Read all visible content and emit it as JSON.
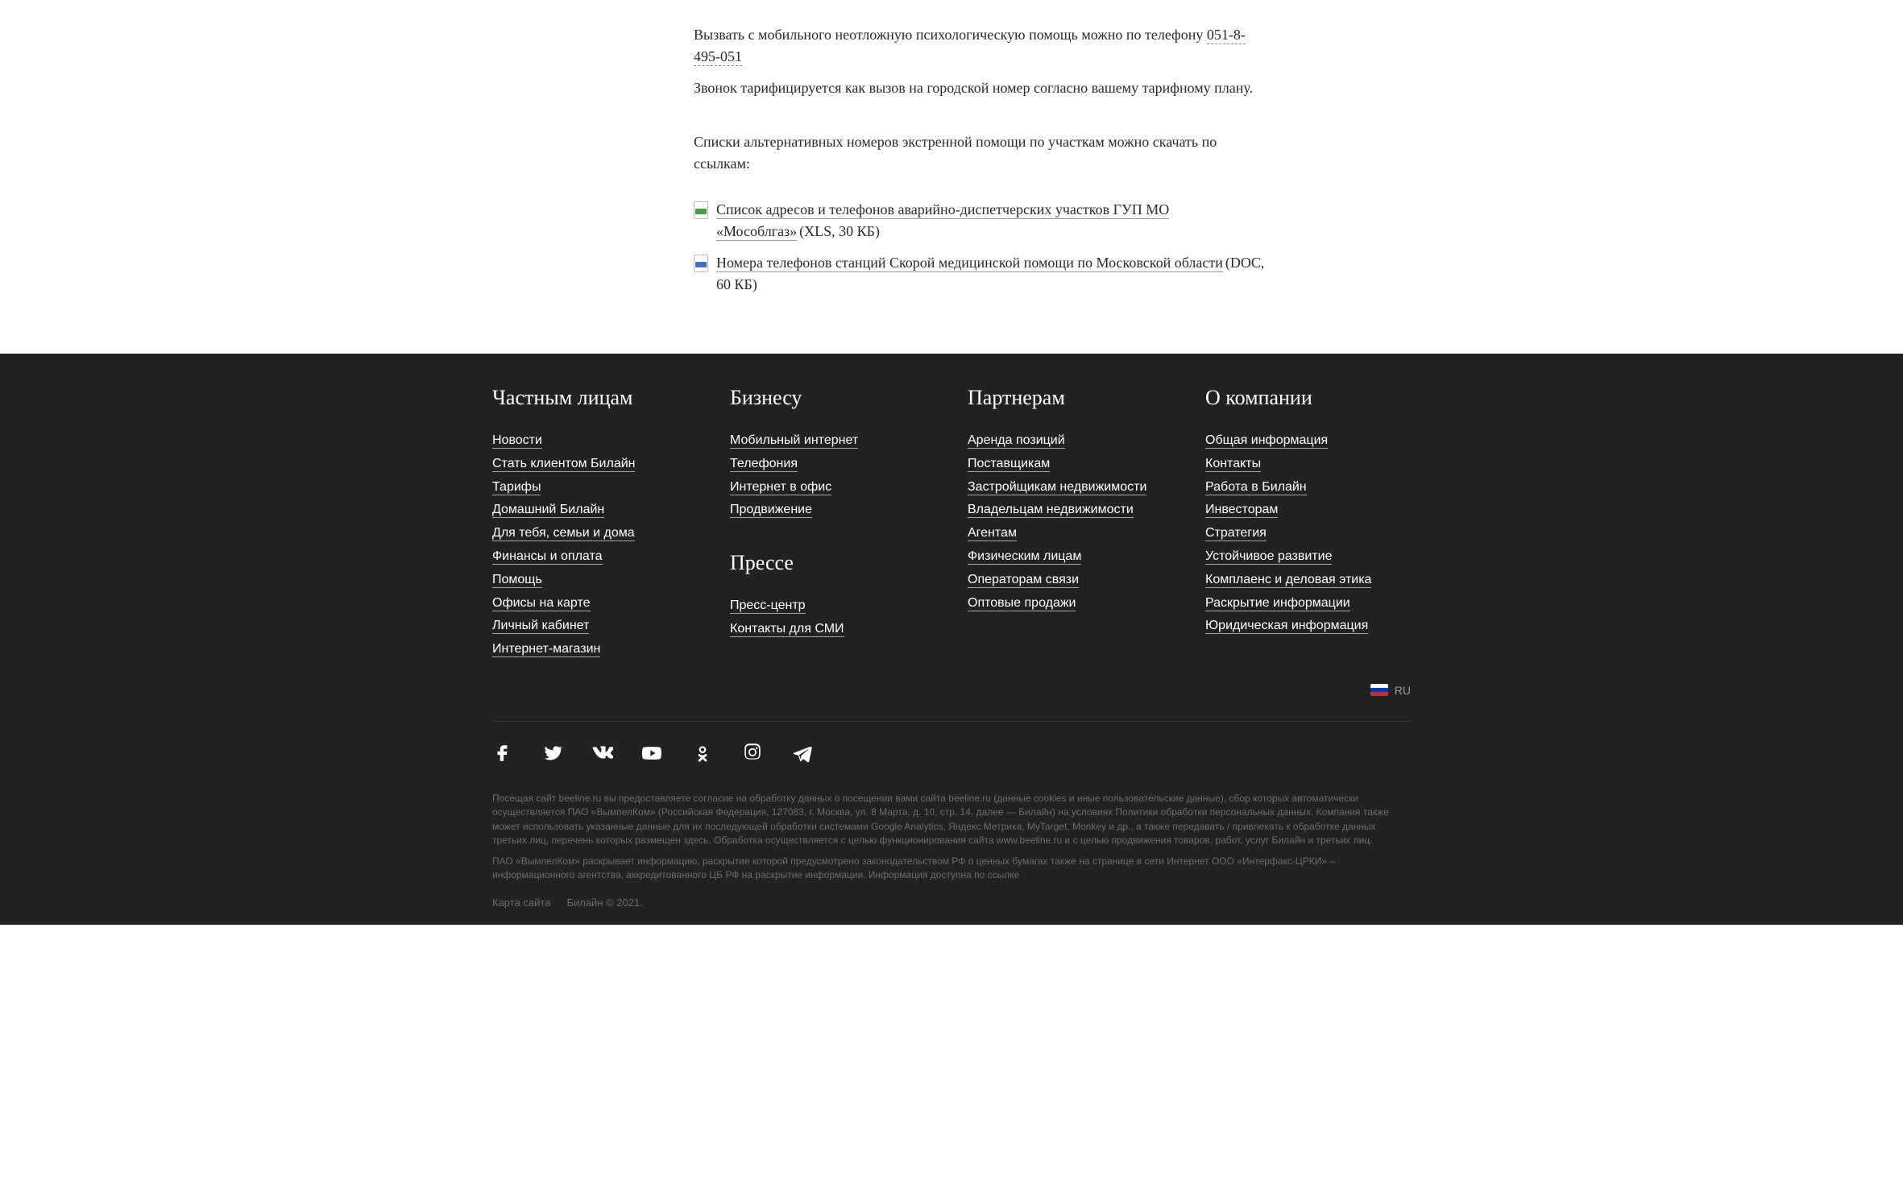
{
  "article": {
    "p1a": "Вызвать с мобильного неотложную психологическую помощь можно по телефону ",
    "phone": "051-8-495-051",
    "p1b": "Звонок тарифицируется как вызов на городской номер согласно вашему тарифному плану.",
    "p2": "Списки альтернативных номеров экстренной помощи по участкам можно скачать по ссылкам:",
    "files": [
      {
        "icon": "xls",
        "link": "Список адресов и телефонов аварийно-диспетчерских участков ГУП МО «Мособлгаз»",
        "meta": "(XLS, 30 КБ)"
      },
      {
        "icon": "doc",
        "link": "Номера телефонов станций Скорой медицинской помощи по Московской области",
        "meta": "(DOC, 60 КБ)"
      }
    ]
  },
  "footer": {
    "cols": [
      {
        "title": "Частным лицам",
        "links": [
          "Новости",
          "Стать клиентом Билайн",
          "Тарифы",
          "Домашний Билайн",
          "Для тебя, семьи и дома",
          "Финансы и оплата",
          "Помощь",
          "Офисы на карте",
          "Личный кабинет",
          "Интернет-магазин"
        ]
      },
      {
        "title": "Бизнесу",
        "links": [
          "Мобильный интернет",
          "Телефония",
          "Интернет в офис",
          "Продвижение"
        ],
        "group2": {
          "title": "Прессе",
          "links": [
            "Пресс-центр",
            "Контакты для СМИ"
          ]
        }
      },
      {
        "title": "Партнерам",
        "links": [
          "Аренда позиций",
          "Поставщикам",
          "Застройщикам недвижимости",
          "Владельцам недвижимости",
          "Агентам",
          "Физическим лицам",
          "Операторам связи",
          "Оптовые продажи"
        ]
      },
      {
        "title": "О компании",
        "links": [
          "Общая информация",
          "Контакты",
          "Работа в Билайн",
          "Инвесторам",
          "Стратегия",
          "Устойчивое развитие",
          "Комплаенс и деловая этика",
          "Раскрытие информации",
          "Юридическая информация"
        ]
      }
    ],
    "lang": "RU",
    "legal_p1": "Посещая сайт beeline.ru вы предоставляете согласие на обработку данных о посещении вами сайта beeline.ru (данные cookies и иные пользовательские данные), сбор которых автоматически осуществляется ПАО «ВымпелКом» (Российская Федерация, 127083, г. Москва, ул. 8 Марта, д. 10, стр. 14, далее — Билайн) на условиях Политики обработки персональных данных. Компания также может использовать указанные данные для их последующей обработки системами Google Analytics, Яндекс.Метрика, MyTarget, Monkey и др., а также передавать / привлекать к обработке данных третьих лиц, перечень которых размещен здесь. Обработка осуществляется с целью функционирования сайта www.beeline.ru и с целью продвижения товаров, работ, услуг Билайн и третьих лиц.",
    "legal_p2": "ПАО «ВымпелКом» раскрывает информацию, раскрытие которой предусмотрено законодательством РФ о ценных бумагах также на странице в сети Интернет ООО «Интерфакс-ЦРКИ» – информационного агентства, аккредитованного ЦБ РФ на раскрытие информации. Информация доступна по ссылке",
    "sitemap": "Карта сайта",
    "copyright": "Билайн © 2021."
  }
}
